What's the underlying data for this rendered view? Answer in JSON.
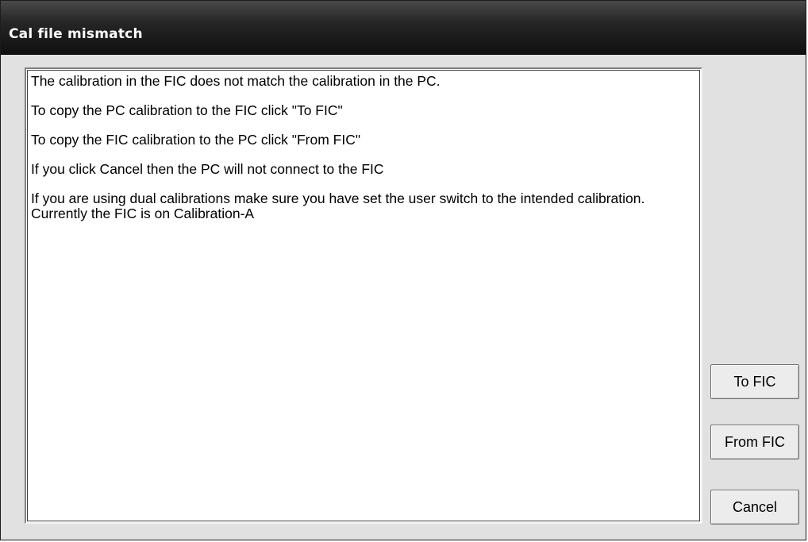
{
  "window": {
    "title": "Cal file mismatch"
  },
  "message": {
    "lines": [
      "The calibration in the FIC does not match the calibration in the PC.",
      "To copy the PC calibration to the FIC click \"To FIC\"",
      "To copy the FIC calibration to the PC click \"From FIC\"",
      "If you click Cancel then the PC will not connect to the FIC",
      "If you are using dual calibrations make sure you have set the user switch to the intended calibration.",
      "Currently the FIC is on Calibration-A"
    ]
  },
  "buttons": {
    "to_fic": "To FIC",
    "from_fic": "From FIC",
    "cancel": "Cancel"
  }
}
